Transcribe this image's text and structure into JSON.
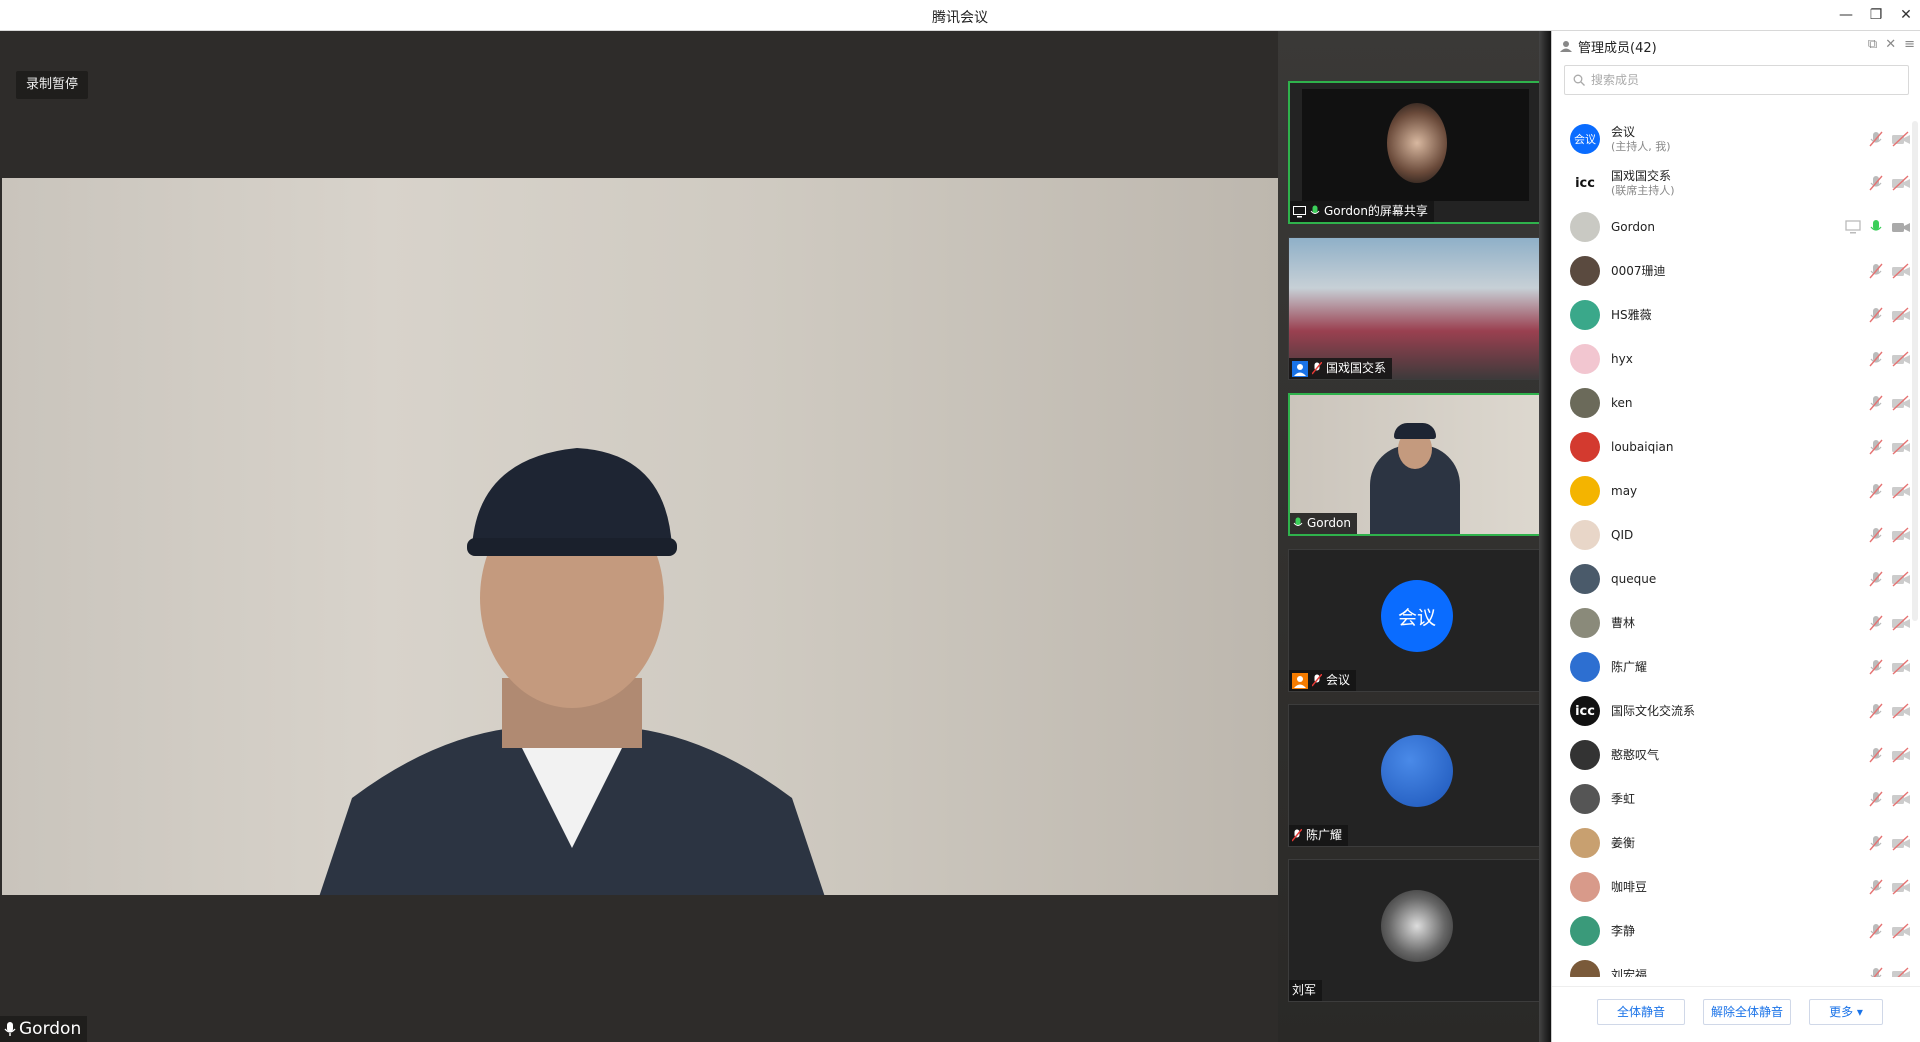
{
  "window": {
    "title": "腾讯会议"
  },
  "main": {
    "recording_status": "录制暂停",
    "speaker_name": "Gordon"
  },
  "tiles": [
    {
      "label": "Gordon的屏幕共享"
    },
    {
      "label": "国戏国交系"
    },
    {
      "label": "Gordon"
    },
    {
      "label": "会议",
      "avatar_text": "会议"
    },
    {
      "label": "陈广耀"
    },
    {
      "label": "刘军"
    }
  ],
  "sidebar": {
    "title": "管理成员(42)",
    "search_placeholder": "搜索成员",
    "members": [
      {
        "name": "会议",
        "role": "(主持人, 我)",
        "avatar_text": "会议",
        "color": "#0a6cff"
      },
      {
        "name": "国戏国交系",
        "role": "(联席主持人)",
        "avatar_text": "icc",
        "color": "#ffffff"
      },
      {
        "name": "Gordon",
        "role": "",
        "avatar_text": "",
        "color": "#c9c9c3"
      },
      {
        "name": "0007珊迪",
        "role": "",
        "avatar_text": "",
        "color": "#5a4a3f"
      },
      {
        "name": "HS雅薇",
        "role": "",
        "avatar_text": "",
        "color": "#3aa88a"
      },
      {
        "name": "hyx",
        "role": "",
        "avatar_text": "",
        "color": "#f2c6d0"
      },
      {
        "name": "ken",
        "role": "",
        "avatar_text": "",
        "color": "#6b6a5a"
      },
      {
        "name": "loubaiqian",
        "role": "",
        "avatar_text": "",
        "color": "#d33a2f"
      },
      {
        "name": "may",
        "role": "",
        "avatar_text": "",
        "color": "#f4b400"
      },
      {
        "name": "QID",
        "role": "",
        "avatar_text": "",
        "color": "#e8d6c8"
      },
      {
        "name": "queque",
        "role": "",
        "avatar_text": "",
        "color": "#4a5a6a"
      },
      {
        "name": "曹林",
        "role": "",
        "avatar_text": "",
        "color": "#8a8a7a"
      },
      {
        "name": "陈广耀",
        "role": "",
        "avatar_text": "",
        "color": "#2d6fd1"
      },
      {
        "name": "国际文化交流系",
        "role": "",
        "avatar_text": "icc",
        "color": "#111111"
      },
      {
        "name": "憨憨叹气",
        "role": "",
        "avatar_text": "",
        "color": "#333333"
      },
      {
        "name": "季虹",
        "role": "",
        "avatar_text": "",
        "color": "#555555"
      },
      {
        "name": "姜衡",
        "role": "",
        "avatar_text": "",
        "color": "#c8a070"
      },
      {
        "name": "咖啡豆",
        "role": "",
        "avatar_text": "",
        "color": "#d89a8a"
      },
      {
        "name": "李静",
        "role": "",
        "avatar_text": "",
        "color": "#3a9a7a"
      },
      {
        "name": "刘宏福",
        "role": "",
        "avatar_text": "",
        "color": "#7a5a3a"
      }
    ],
    "footer": {
      "mute_all": "全体静音",
      "unmute_all": "解除全体静音",
      "more": "更多 ▾"
    }
  }
}
